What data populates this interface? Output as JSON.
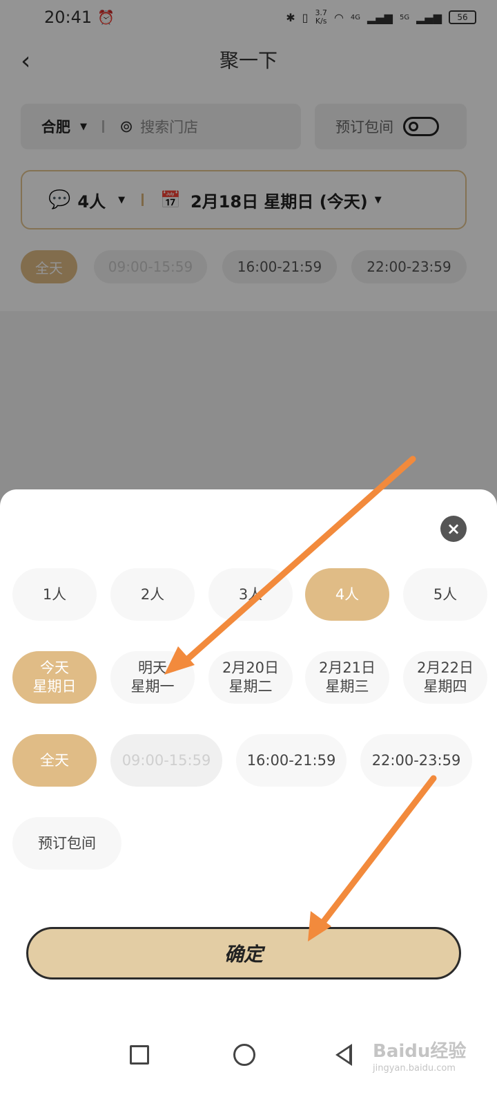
{
  "status_bar": {
    "time": "20:41",
    "speed_top": "3.7",
    "speed_bottom": "K/s",
    "net1": "4G",
    "net2": "5G",
    "battery": "56"
  },
  "header": {
    "title": "聚一下"
  },
  "search": {
    "city": "合肥",
    "placeholder": "搜索门店",
    "private_room_label": "预订包间"
  },
  "filter": {
    "people": "4人",
    "date": "2月18日 星期日 (今天)"
  },
  "top_time_chips": [
    {
      "label": "全天"
    },
    {
      "label": "09:00-15:59"
    },
    {
      "label": "16:00-21:59"
    },
    {
      "label": "22:00-23:59"
    }
  ],
  "sheet": {
    "people_options": [
      "1人",
      "2人",
      "3人",
      "4人",
      "5人"
    ],
    "selected_people": "4人",
    "dates": [
      {
        "line1": "今天",
        "line2": "星期日"
      },
      {
        "line1": "明天",
        "line2": "星期一"
      },
      {
        "line1": "2月20日",
        "line2": "星期二"
      },
      {
        "line1": "2月21日",
        "line2": "星期三"
      },
      {
        "line1": "2月22日",
        "line2": "星期四"
      }
    ],
    "time_options": [
      "全天",
      "09:00-15:59",
      "16:00-21:59",
      "22:00-23:59"
    ],
    "private_room": "预订包间",
    "confirm": "确定"
  },
  "watermark": {
    "brand": "Baidu经验",
    "url": "jingyan.baidu.com"
  },
  "colors": {
    "accent": "#e0bc86",
    "confirm_bg": "#e3cda4",
    "arrow": "#f28a3c"
  }
}
